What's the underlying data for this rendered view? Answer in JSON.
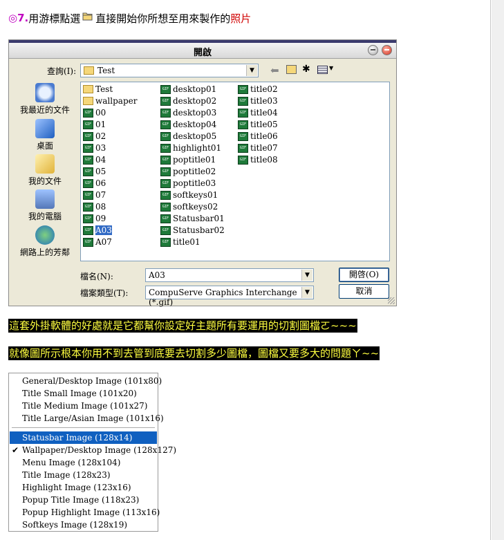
{
  "step": {
    "number": "◎7.",
    "text_before": "用游標點選",
    "text_after": "直接開始你所想至用來製作的",
    "highlight": "照片"
  },
  "dialog": {
    "title": "開啟",
    "lookin_label": "查詢(I):",
    "lookin_value": "Test",
    "places": [
      {
        "label": "我最近的文件",
        "icon": "recent-docs-icon"
      },
      {
        "label": "桌面",
        "icon": "desktop-icon"
      },
      {
        "label": "我的文件",
        "icon": "my-documents-icon"
      },
      {
        "label": "我的電腦",
        "icon": "my-computer-icon"
      },
      {
        "label": "網路上的芳鄰",
        "icon": "network-icon"
      }
    ],
    "files_col1": [
      "Test",
      "wallpaper",
      "00",
      "01",
      "02",
      "03",
      "04",
      "05",
      "06",
      "07",
      "08",
      "09",
      "A03",
      "A07"
    ],
    "files_col2": [
      "desktop01",
      "desktop02",
      "desktop03",
      "desktop04",
      "desktop05",
      "highlight01",
      "poptitle01",
      "poptitle02",
      "poptitle03",
      "softkeys01",
      "softkeys02",
      "Statusbar01",
      "Statusbar02",
      "title01"
    ],
    "files_col3": [
      "title02",
      "title03",
      "title04",
      "title05",
      "title06",
      "title07",
      "title08"
    ],
    "selected_file": "A03",
    "filename_label": "檔名(N):",
    "filename_value": "A03",
    "filetype_label": "檔案類型(T):",
    "filetype_value": "CompuServe Graphics Interchange (*.gif)",
    "open_button": "開啓(O)",
    "cancel_button": "取消"
  },
  "notes": {
    "line1": "這套外掛軟體的好處就是它都幫你設定好主題所有要運用的切割圖檔ㄛ~~~",
    "line2": "就像圖所示根本你用不到去管到底要去切割多少圖檔，圖檔又要多大的問題ㄚ~~"
  },
  "menu": {
    "group1": [
      "General/Desktop Image (101x80)",
      "Title Small Image (101x20)",
      "Title Medium Image (101x27)",
      "Title Large/Asian Image (101x16)"
    ],
    "group2": [
      "Statusbar Image (128x14)",
      "Wallpaper/Desktop Image (128x127)",
      "Menu Image (128x104)",
      "Title Image (128x23)",
      "Highlight Image (123x16)",
      "Popup Title Image (118x23)",
      "Popup Highlight Image (113x16)",
      "Softkeys Image (128x19)"
    ],
    "active_item": "Statusbar Image (128x14)",
    "checked_item": "Wallpaper/Desktop Image (128x127)",
    "check_glyph": "✔"
  }
}
